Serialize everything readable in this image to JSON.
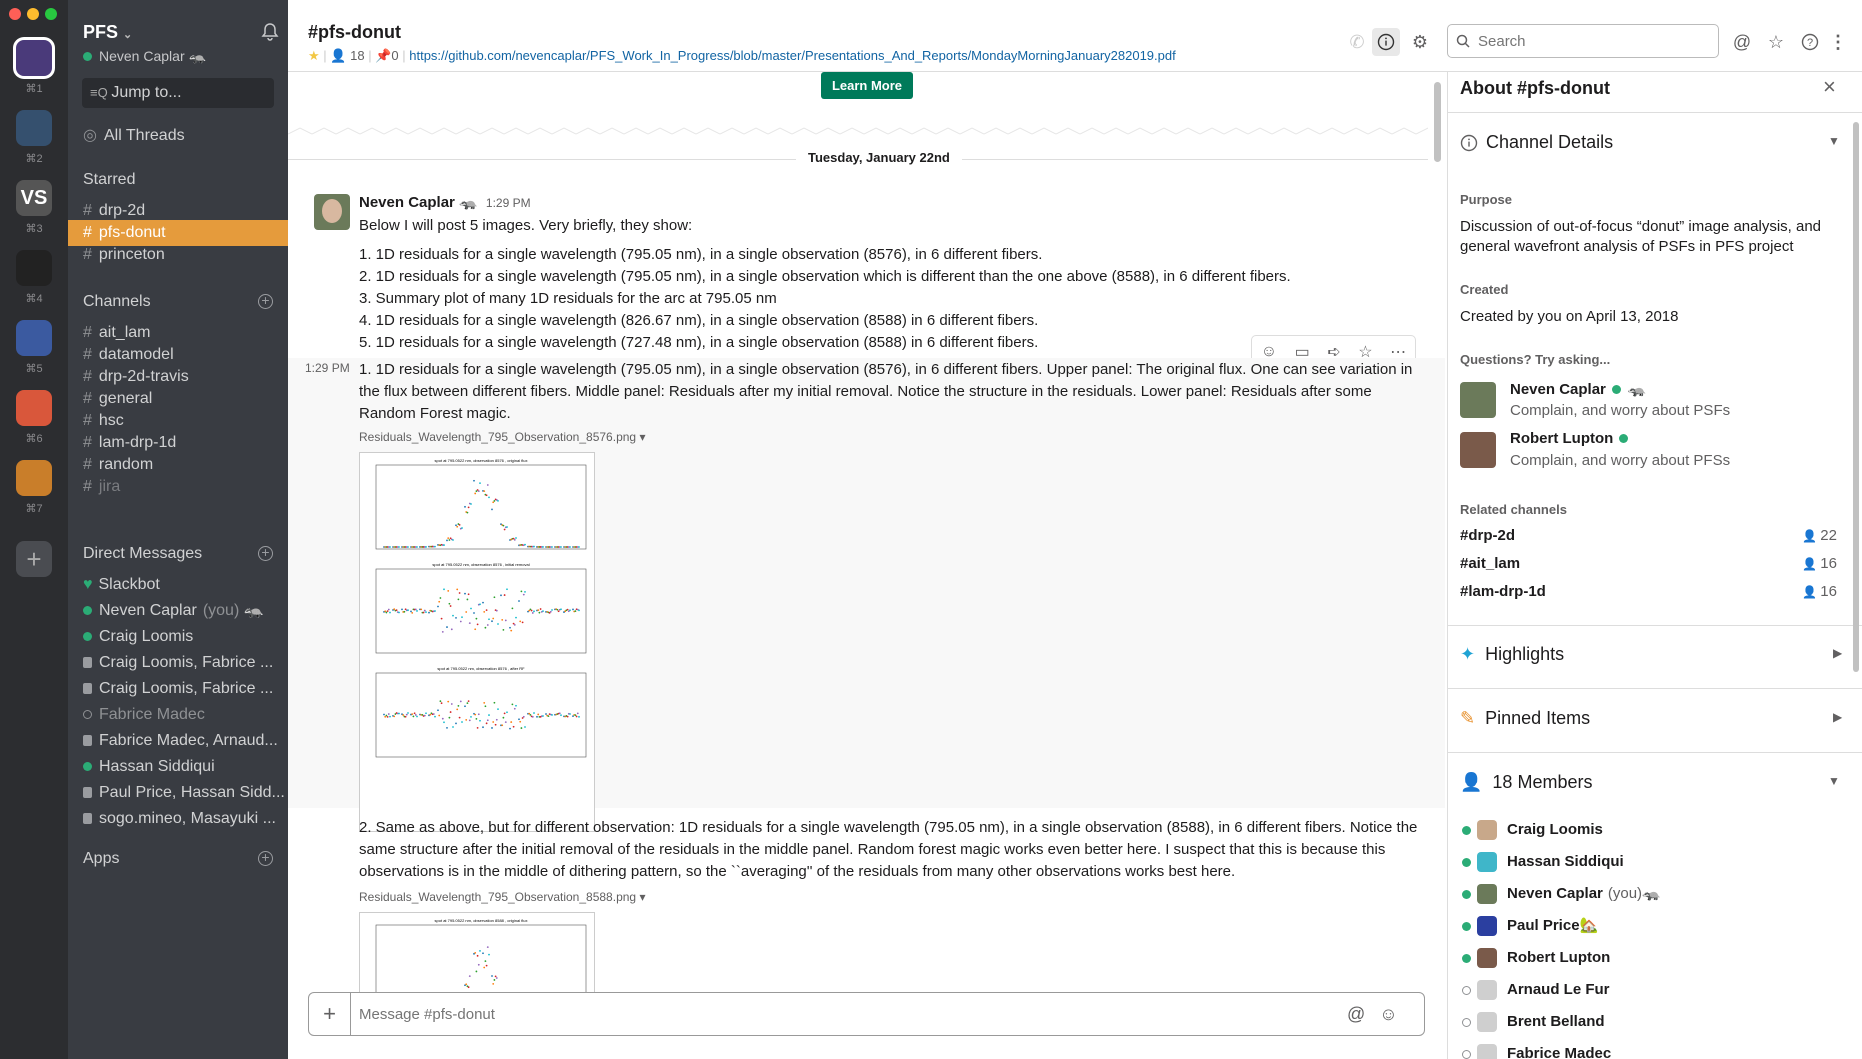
{
  "workspaces": [
    {
      "letter": "",
      "shortcut": "⌘1",
      "color": "#4a3a7a"
    },
    {
      "letter": "",
      "shortcut": "⌘2",
      "color": "#35506e"
    },
    {
      "letter": "VS",
      "shortcut": "⌘3",
      "color": "#555"
    },
    {
      "letter": "",
      "shortcut": "⌘4",
      "color": "#222"
    },
    {
      "letter": "",
      "shortcut": "⌘5",
      "color": "#3b5aa0"
    },
    {
      "letter": "",
      "shortcut": "⌘6",
      "color": "#d9573b"
    },
    {
      "letter": "",
      "shortcut": "⌘7",
      "color": "#c97e2a"
    }
  ],
  "sidebar": {
    "team": "PFS",
    "user": "Neven Caplar",
    "jump": "Jump to...",
    "all_threads": "All Threads",
    "starred_label": "Starred",
    "starred": [
      "drp-2d",
      "pfs-donut",
      "princeton"
    ],
    "channels_label": "Channels",
    "channels": [
      "ait_lam",
      "datamodel",
      "drp-2d-travis",
      "general",
      "hsc",
      "lam-drp-1d",
      "random",
      "jira"
    ],
    "dm_label": "Direct Messages",
    "dms": [
      {
        "name": "Slackbot",
        "status": "heart"
      },
      {
        "name": "Neven Caplar",
        "suffix": "(you)",
        "status": "online"
      },
      {
        "name": "Craig Loomis",
        "status": "online"
      },
      {
        "name": "Craig Loomis, Fabrice ...",
        "status": "group",
        "n": "2"
      },
      {
        "name": "Craig Loomis, Fabrice ...",
        "status": "group",
        "n": "3"
      },
      {
        "name": "Fabrice Madec",
        "status": "away"
      },
      {
        "name": "Fabrice Madec, Arnaud...",
        "status": "group",
        "n": "3"
      },
      {
        "name": "Hassan Siddiqui",
        "status": "online"
      },
      {
        "name": "Paul Price, Hassan Sidd...",
        "status": "group",
        "n": "2"
      },
      {
        "name": "sogo.mineo, Masayuki ...",
        "status": "group",
        "n": "2"
      }
    ],
    "apps_label": "Apps"
  },
  "header": {
    "channel": "#pfs-donut",
    "members": "18",
    "pins": "0",
    "topic_link": "https://github.com/nevencaplar/PFS_Work_In_Progress/blob/master/Presentations_And_Reports/MondayMorningJanuary282019.pdf",
    "search_placeholder": "Search"
  },
  "main": {
    "learn_more": "Learn More",
    "date_divider": "Tuesday, January 22nd",
    "author": "Neven Caplar",
    "time": "1:29 PM",
    "intro": "Below I will post 5 images. Very briefly, they show:",
    "list": [
      "1. 1D residuals for a single wavelength (795.05 nm), in a single observation (8576), in 6 different fibers.",
      "2. 1D residuals for a single wavelength (795.05 nm), in a single observation which is different than the one above (8588), in 6 different fibers.",
      "3. Summary plot of many 1D residuals for the arc at 795.05 nm",
      "4. 1D residuals for a single wavelength (826.67 nm), in a single observation (8588) in 6 different fibers.",
      "5. 1D residuals for a single wavelength (727.48 nm), in a single observation (8588) in 6 different fibers."
    ],
    "msg2_time": "1:29 PM",
    "msg2": "1. 1D residuals for a single wavelength (795.05 nm), in a single observation (8576), in 6 different fibers. Upper panel: The original flux. One can see variation in the flux between different fibers. Middle panel: Residuals after my initial removal. Notice the structure in the residuals. Lower panel: Residuals after some Random Forest magic.",
    "file1": "Residuals_Wavelength_795_Observation_8576.png",
    "plot1_titles": [
      "spot at 795.0522 nm, observation 8576 , original flux",
      "spot at 795.0522 nm, observation 8576 , initial removal",
      "spot at 795.0522 nm, observation 8576 , after RF"
    ],
    "msg3": "2. Same as above, but for different observation: 1D residuals for a single wavelength (795.05 nm), in a single observation (8588), in 6 different fibers. Notice the same structure after the initial removal of the residuals in the middle panel. Random forest magic works even better here. I suspect that this is because this observations is in the middle of dithering pattern, so the ``averaging'' of the residuals from many other observations works best here.",
    "file2": "Residuals_Wavelength_795_Observation_8588.png",
    "plot2_title": "spot at 795.0522 nm, observation 8588 , original flux",
    "composer_placeholder": "Message #pfs-donut"
  },
  "panel": {
    "title": "About #pfs-donut",
    "details": "Channel Details",
    "purpose_label": "Purpose",
    "purpose": "Discussion of out-of-focus “donut” image analysis, and general wavefront analysis of PSFs in PFS project",
    "created_label": "Created",
    "created": "Created by you on April 13, 2018",
    "questions_label": "Questions? Try asking...",
    "people": [
      {
        "name": "Neven Caplar",
        "desc": "Complain, and worry about PSFs"
      },
      {
        "name": "Robert Lupton",
        "desc": "Complain, and worry about PFSs"
      }
    ],
    "related_label": "Related channels",
    "related": [
      {
        "name": "#drp-2d",
        "count": "22"
      },
      {
        "name": "#ait_lam",
        "count": "16"
      },
      {
        "name": "#lam-drp-1d",
        "count": "16"
      }
    ],
    "highlights": "Highlights",
    "pinned": "Pinned Items",
    "members_title": "18 Members",
    "members": [
      {
        "name": "Craig Loomis",
        "online": true,
        "color": "#c8a88a"
      },
      {
        "name": "Hassan Siddiqui",
        "online": true,
        "color": "#3fb6c9"
      },
      {
        "name": "Neven Caplar",
        "suffix": "(you)",
        "online": true,
        "color": "#6b7a5a"
      },
      {
        "name": "Paul Price",
        "online": true,
        "color": "#2b3fa0"
      },
      {
        "name": "Robert Lupton",
        "online": true,
        "color": "#7a5a4a"
      },
      {
        "name": "Arnaud Le Fur",
        "online": false,
        "color": "#cfcfcf"
      },
      {
        "name": "Brent Belland",
        "online": false,
        "color": "#cfcfcf"
      },
      {
        "name": "Fabrice Madec",
        "online": false,
        "color": "#cfcfcf"
      }
    ]
  }
}
